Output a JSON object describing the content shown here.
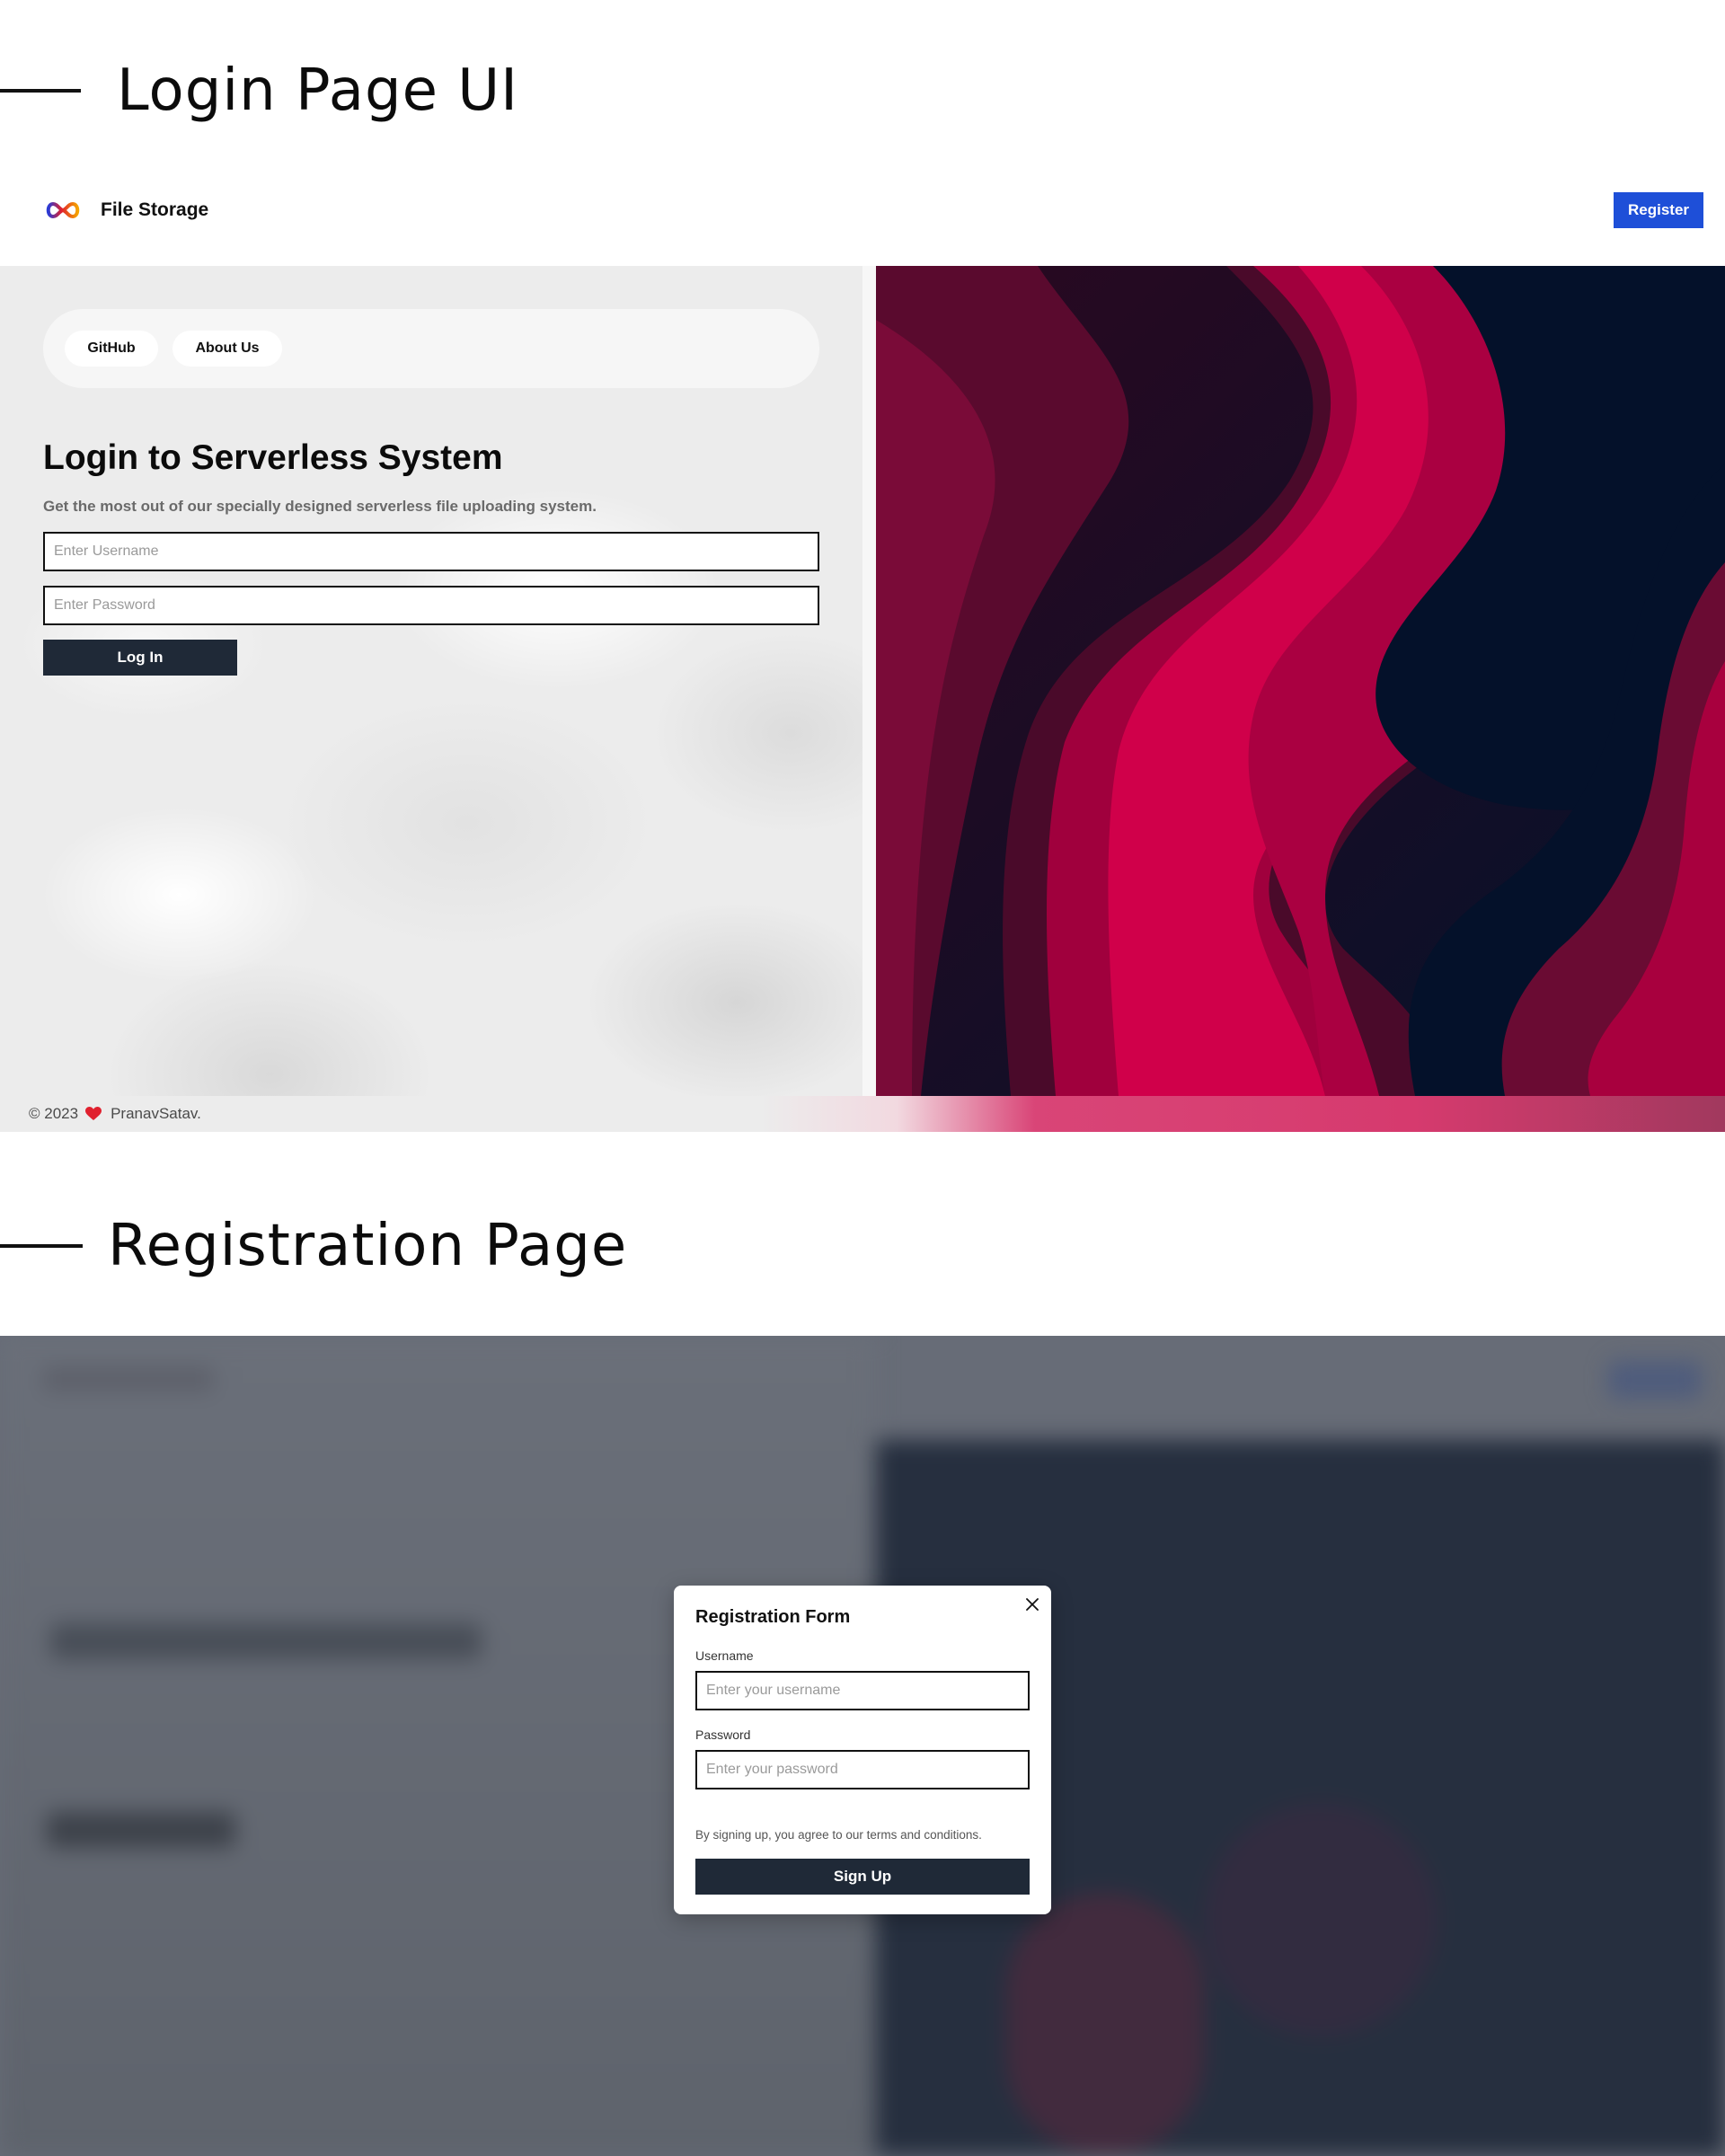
{
  "sections": {
    "login_heading": "Login Page UI",
    "registration_heading": "Registration Page"
  },
  "navbar": {
    "brand_name": "File Storage",
    "brand_icon": "infinity-logo-icon",
    "register_label": "Register"
  },
  "login": {
    "pills": [
      "GitHub",
      "About Us"
    ],
    "title": "Login to Serverless System",
    "subtitle": "Get the most out of our specially designed serverless file uploading system.",
    "username_placeholder": "Enter Username",
    "password_placeholder": "Enter Password",
    "login_label": "Log In"
  },
  "footer": {
    "copyright": "© 2023",
    "heart_icon": "heart-icon",
    "author": "PranavSatav."
  },
  "registration": {
    "title": "Registration Form",
    "username_label": "Username",
    "username_placeholder": "Enter your username",
    "password_label": "Password",
    "password_placeholder": "Enter your password",
    "terms": "By signing up, you agree to our terms and conditions.",
    "signup_label": "Sign Up",
    "close_icon": "close-icon"
  },
  "colors": {
    "accent_blue": "#1e4fd8",
    "dark_button": "#1f2937",
    "heart_red": "#e0202e",
    "wave_pink": "#d0004a",
    "wave_navy": "#04112a"
  }
}
